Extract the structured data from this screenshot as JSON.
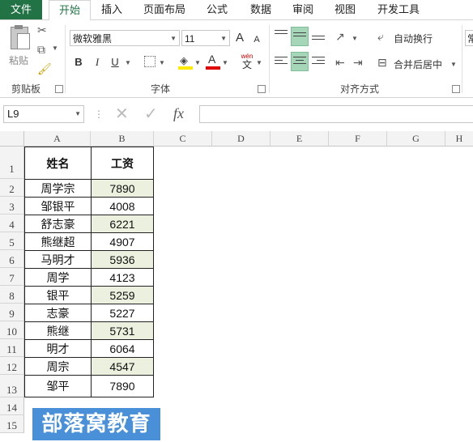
{
  "tabs": [
    "文件",
    "开始",
    "插入",
    "页面布局",
    "公式",
    "数据",
    "审阅",
    "视图",
    "开发工具"
  ],
  "ribbon": {
    "clipboard": {
      "paste_label": "粘贴",
      "group_label": "剪贴板"
    },
    "font": {
      "name": "微软雅黑",
      "size": "11",
      "grow": "A",
      "shrink": "A",
      "bold": "B",
      "italic": "I",
      "underline": "U",
      "wen": "wén",
      "wen_char": "文",
      "group_label": "字体"
    },
    "alignment": {
      "wrap_text": "自动换行",
      "merge_center": "合并后居中",
      "group_label": "对齐方式"
    },
    "number_partial": "常"
  },
  "formula_bar": {
    "name_box": "L9",
    "fx": "fx",
    "formula": ""
  },
  "columns": [
    "A",
    "B",
    "C",
    "D",
    "E",
    "F",
    "G",
    "H"
  ],
  "rows": [
    "1",
    "2",
    "3",
    "4",
    "5",
    "6",
    "7",
    "8",
    "9",
    "10",
    "11",
    "12",
    "13",
    "14",
    "15"
  ],
  "table": {
    "headers": [
      "姓名",
      "工资"
    ],
    "rows": [
      [
        "周学宗",
        "7890"
      ],
      [
        "邹银平",
        "4008"
      ],
      [
        "舒志豪",
        "6221"
      ],
      [
        "熊继超",
        "4907"
      ],
      [
        "马明才",
        "5936"
      ],
      [
        "周学",
        "4123"
      ],
      [
        "银平",
        "5259"
      ],
      [
        "志豪",
        "5227"
      ],
      [
        "熊继",
        "5731"
      ],
      [
        "明才",
        "6064"
      ],
      [
        "周宗",
        "4547"
      ],
      [
        "邹平",
        "7890"
      ]
    ]
  },
  "watermark": "部落窝教育",
  "colors": {
    "accent": "#217346",
    "shaded_cell": "#ebf1de",
    "watermark_bg": "#4a90d9"
  }
}
